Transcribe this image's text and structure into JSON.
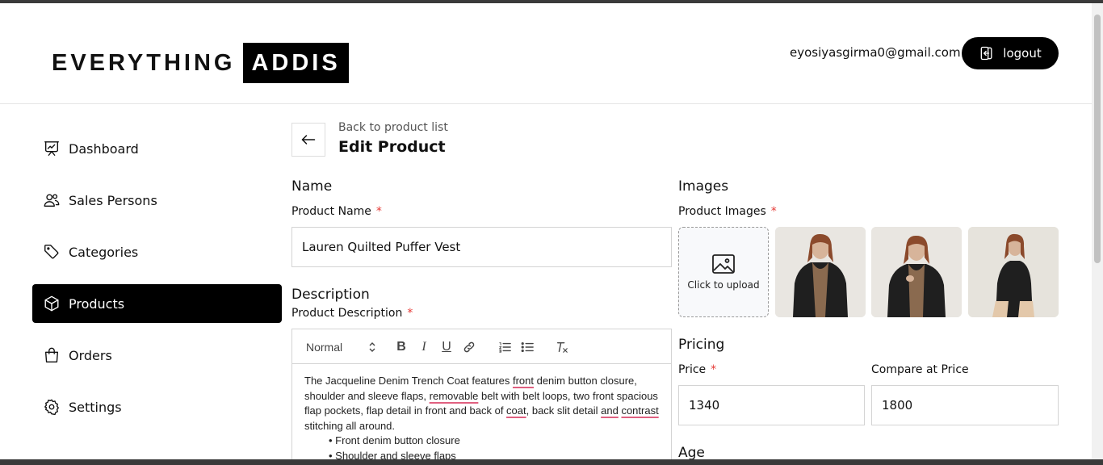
{
  "header": {
    "logo_part1": "EVERYTHING",
    "logo_part2": "ADDIS",
    "user_email": "eyosiyasgirma0@gmail.com",
    "logout_label": "logout"
  },
  "sidebar": {
    "items": [
      {
        "label": "Dashboard",
        "icon": "presentation-chart-icon"
      },
      {
        "label": "Sales Persons",
        "icon": "users-icon"
      },
      {
        "label": "Categories",
        "icon": "tag-icon"
      },
      {
        "label": "Products",
        "icon": "cube-icon",
        "active": true
      },
      {
        "label": "Orders",
        "icon": "shopping-bag-icon"
      },
      {
        "label": "Settings",
        "icon": "gear-icon"
      }
    ]
  },
  "page": {
    "back_label": "Back to product list",
    "title": "Edit Product"
  },
  "name_section": {
    "title": "Name",
    "field_label": "Product Name",
    "required_mark": "*",
    "value": "Lauren Quilted Puffer Vest"
  },
  "description_section": {
    "title": "Description",
    "field_label": "Product Description",
    "required_mark": "*",
    "toolbar": {
      "format_select": "Normal",
      "bold": "B",
      "italic": "I",
      "underline": "U"
    },
    "text": {
      "p1": "The Jacqueline Denim Trench Coat features ",
      "w_front": "front",
      "p2": " denim button closure, shoulder and sleeve flaps, ",
      "w_removable": "removable",
      "p3": " belt with belt loops, two front spacious flap pockets, flap detail in front and back of ",
      "w_coat": "coat",
      "p4": ", back slit detail ",
      "w_and": "and",
      "p5": " ",
      "w_contrast": "contrast",
      "p6": " stitching all around."
    },
    "bullets": [
      "Front denim button closure",
      "Shoulder and sleeve flaps"
    ]
  },
  "images_section": {
    "title": "Images",
    "field_label": "Product Images",
    "required_mark": "*",
    "upload_label": "Click to upload"
  },
  "pricing_section": {
    "title": "Pricing",
    "price_label": "Price",
    "required_mark": "*",
    "price_value": "1340",
    "compare_label": "Compare at Price",
    "compare_value": "1800"
  },
  "age_section": {
    "title": "Age"
  },
  "colors": {
    "accent": "#000000",
    "required": "#e53935",
    "spellcheck": "#e06080"
  }
}
